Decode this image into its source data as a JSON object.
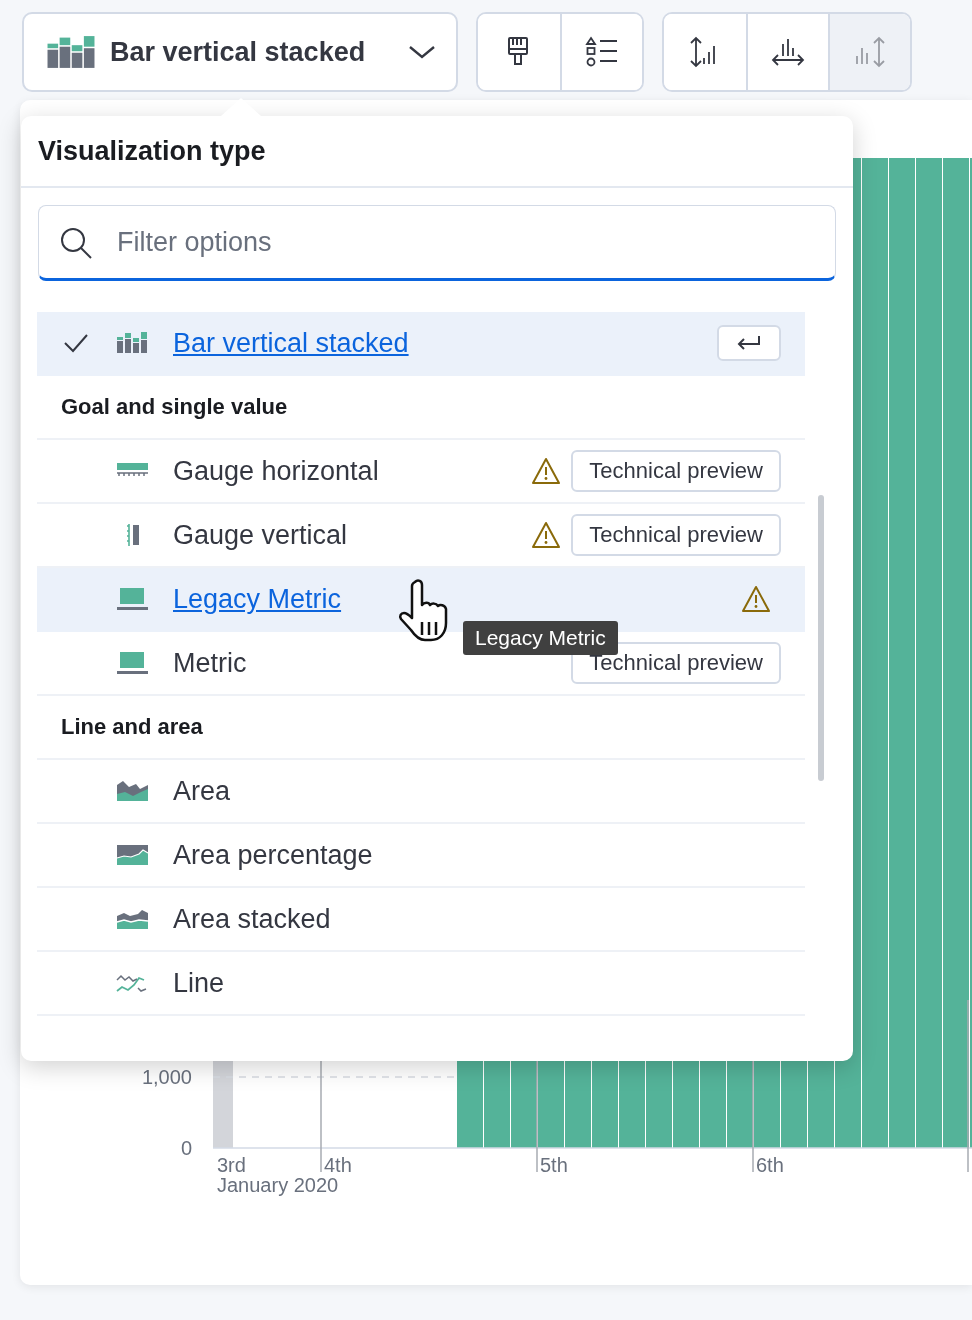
{
  "toolbar": {
    "type_picker": {
      "label": "Bar vertical stacked"
    },
    "buttons": [
      {
        "disabled": false
      },
      {
        "disabled": false
      },
      {
        "disabled": false
      },
      {
        "disabled": false
      },
      {
        "disabled": true
      }
    ]
  },
  "popover": {
    "title": "Visualization type",
    "search": {
      "placeholder": "Filter options"
    },
    "items": [
      {
        "kind": "option",
        "label": "Bar vertical stacked",
        "checked": true,
        "highlighted": true,
        "warning": false
      },
      {
        "kind": "group",
        "label": "Goal and single value"
      },
      {
        "kind": "option",
        "label": "Gauge horizontal",
        "checked": false,
        "highlighted": false,
        "warning": true,
        "badge": "Technical preview"
      },
      {
        "kind": "option",
        "label": "Gauge vertical",
        "checked": false,
        "highlighted": false,
        "warning": true,
        "badge": "Technical preview"
      },
      {
        "kind": "option",
        "label": "Legacy Metric",
        "checked": false,
        "highlighted": true,
        "warning": true
      },
      {
        "kind": "option",
        "label": "Metric",
        "checked": false,
        "highlighted": false,
        "warning": false,
        "badge": "Technical preview"
      },
      {
        "kind": "group",
        "label": "Line and area"
      },
      {
        "kind": "option",
        "label": "Area",
        "checked": false,
        "highlighted": false,
        "warning": false
      },
      {
        "kind": "option",
        "label": "Area percentage",
        "checked": false,
        "highlighted": false,
        "warning": false
      },
      {
        "kind": "option",
        "label": "Area stacked",
        "checked": false,
        "highlighted": false,
        "warning": false
      },
      {
        "kind": "option",
        "label": "Line",
        "checked": false,
        "highlighted": false,
        "warning": false
      }
    ],
    "tooltip": "Legacy Metric"
  },
  "chart": {
    "y_ticks": [
      "1,000",
      "0"
    ],
    "x_labels": [
      "3rd",
      "4th",
      "5th",
      "6th"
    ],
    "x_caption": "January 2020"
  }
}
